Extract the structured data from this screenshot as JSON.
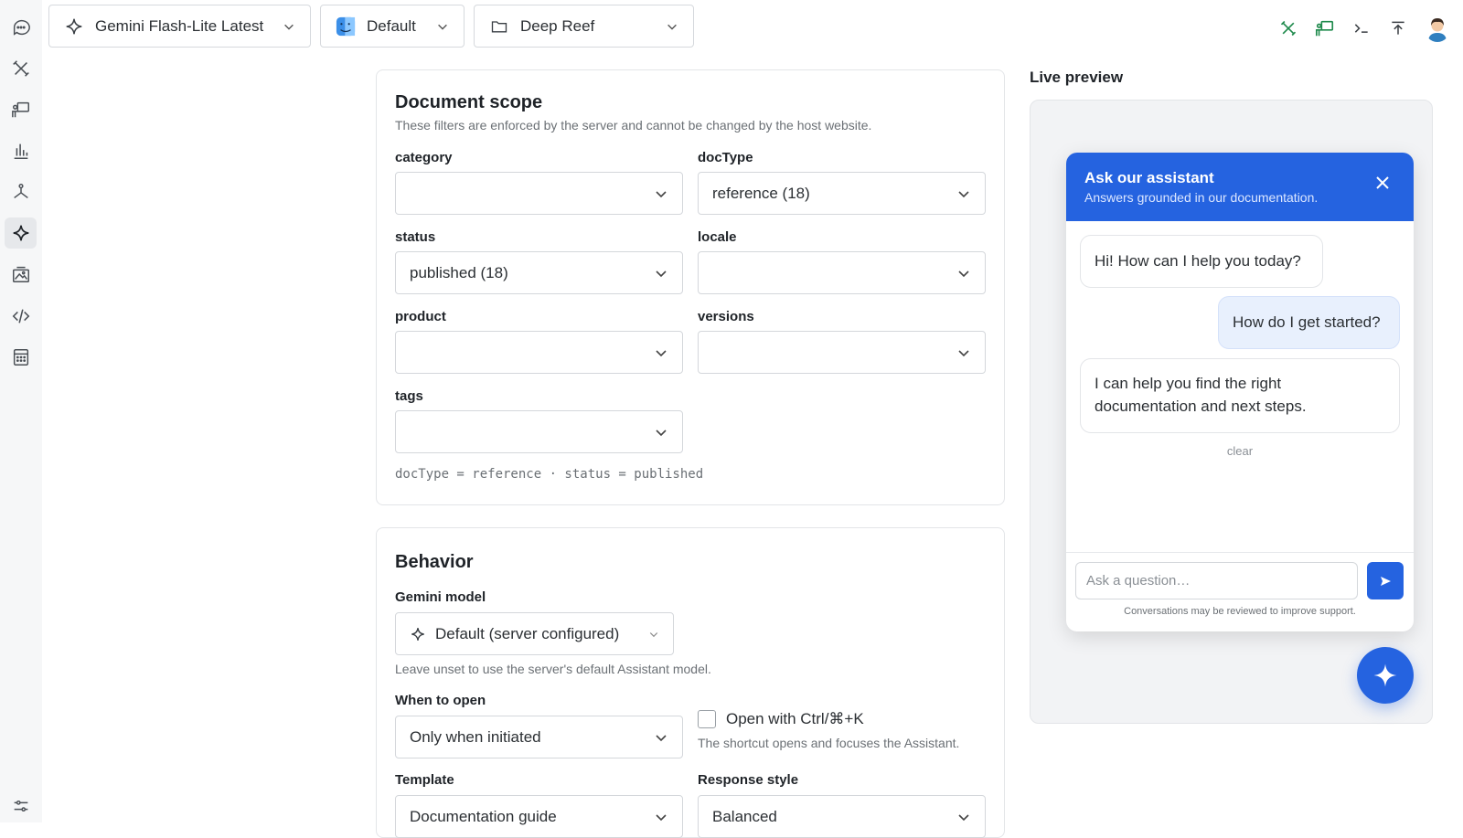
{
  "topbar": {
    "model_label": "Gemini Flash-Lite Latest",
    "profile_label": "Default",
    "folder_label": "Deep Reef"
  },
  "sidebar": {
    "icons": [
      "chat-icon",
      "tools-icon",
      "presenter-icon",
      "bar-chart-icon",
      "graph-icon",
      "sparkle-icon",
      "image-gallery-icon",
      "code-icon",
      "calculator-icon",
      "sliders-icon"
    ],
    "active": "sparkle-icon"
  },
  "scope": {
    "title": "Document scope",
    "subtitle": "These filters are enforced by the server and cannot be changed by the host website.",
    "category_label": "category",
    "category_value": "",
    "doctype_label": "docType",
    "doctype_value": "reference (18)",
    "status_label": "status",
    "status_value": "published (18)",
    "locale_label": "locale",
    "locale_value": "",
    "product_label": "product",
    "product_value": "",
    "versions_label": "versions",
    "versions_value": "",
    "tags_label": "tags",
    "tags_value": "",
    "summary": "docType = reference · status = published"
  },
  "behavior": {
    "title": "Behavior",
    "model_label": "Gemini model",
    "model_value": "Default (server configured)",
    "model_help": "Leave unset to use the server's default Assistant model.",
    "open_label": "When to open",
    "open_value": "Only when initiated",
    "shortcut_label": "Open with Ctrl/⌘+K",
    "shortcut_help": "The shortcut opens and focuses the Assistant.",
    "shortcut_checked": false,
    "template_label": "Template",
    "template_value": "Documentation guide",
    "style_label": "Response style",
    "style_value": "Balanced"
  },
  "preview": {
    "title": "Live preview",
    "widget_title": "Ask our assistant",
    "widget_subtitle": "Answers grounded in our documentation.",
    "messages": [
      {
        "role": "assistant",
        "text": "Hi! How can I help you today?"
      },
      {
        "role": "user",
        "text": "How do I get started?"
      },
      {
        "role": "assistant",
        "text": "I can help you find the right documentation and next steps."
      }
    ],
    "clear_label": "clear",
    "input_placeholder": "Ask a question…",
    "footer_note": "Conversations may be reviewed to improve support.",
    "accent_color": "#2563e0"
  }
}
